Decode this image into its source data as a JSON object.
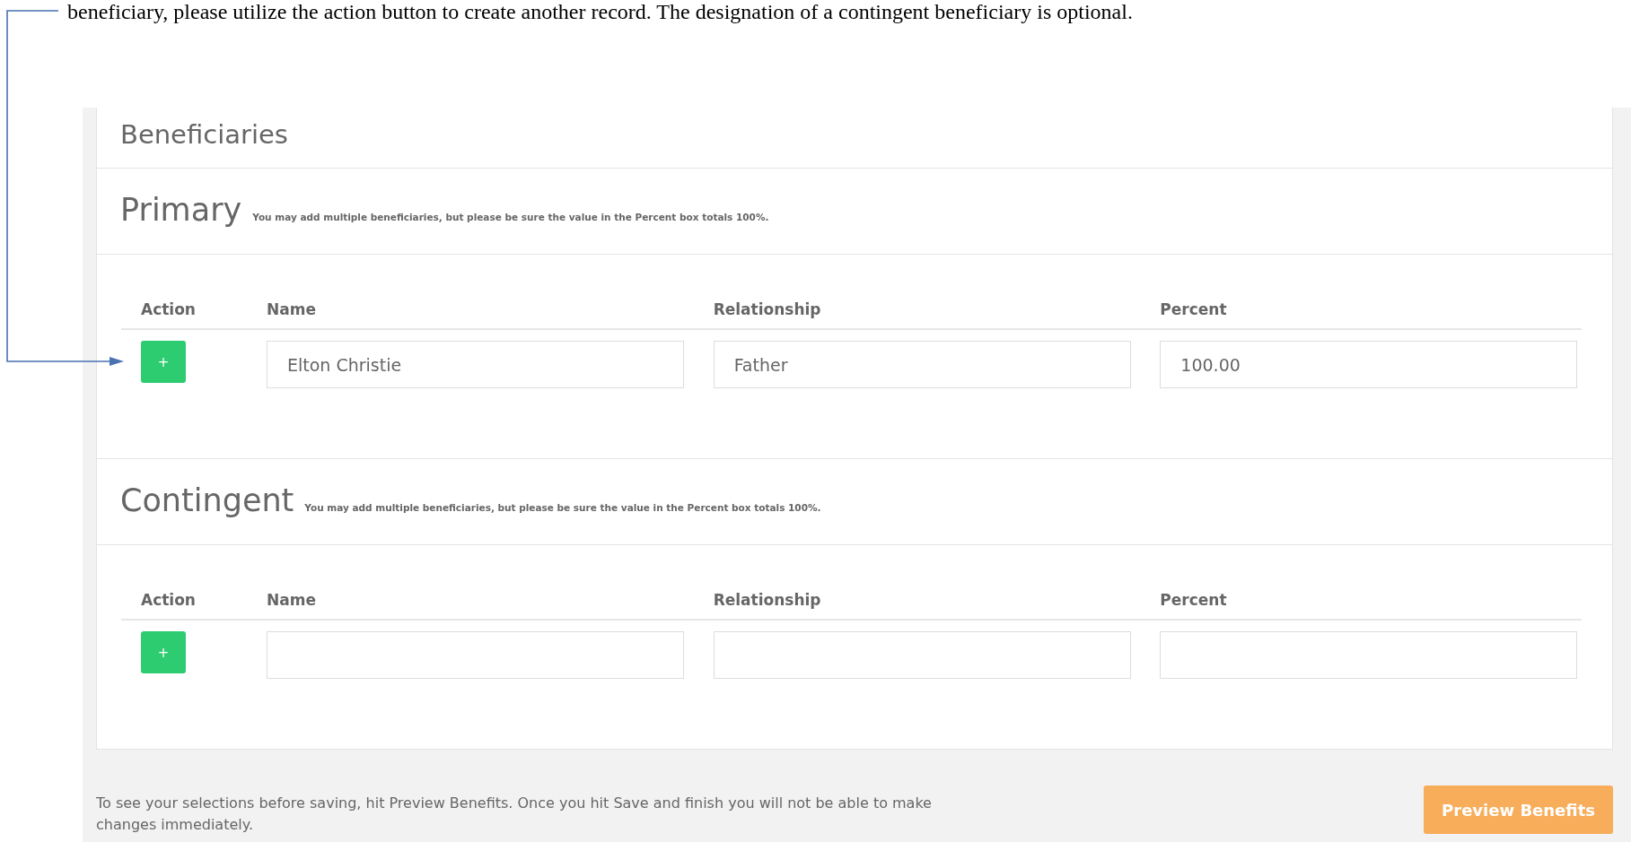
{
  "document_text": "beneficiary, please utilize the action button to create another record.  The designation of a contingent beneficiary is optional.",
  "panel_title": "Beneficiaries",
  "sections": [
    {
      "title": "Primary",
      "note": "You may add multiple beneficiaries, but please be sure the value in the Percent box totals 100%.",
      "columns": [
        "Action",
        "Name",
        "Relationship",
        "Percent"
      ],
      "rows": [
        {
          "action": "+",
          "name": "Elton Christie",
          "relationship": "Father",
          "percent": "100.00"
        }
      ]
    },
    {
      "title": "Contingent",
      "note": "You may add multiple beneficiaries, but please be sure the value in the Percent box totals 100%.",
      "columns": [
        "Action",
        "Name",
        "Relationship",
        "Percent"
      ],
      "rows": [
        {
          "action": "+"
        }
      ]
    }
  ],
  "footer": {
    "text": "To see your selections before saving, hit Preview Benefits. Once you hit Save and finish you will not be able to make changes immediately.",
    "button": "Preview Benefits"
  }
}
